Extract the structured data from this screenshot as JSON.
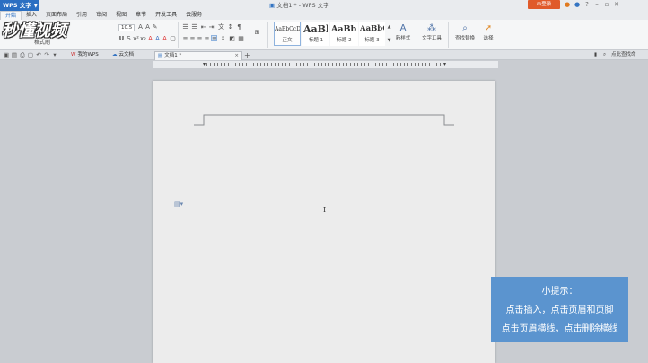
{
  "app": {
    "name": "WPS 文字",
    "title": "文档1 * - WPS 文字",
    "login_label": "未登录"
  },
  "menu": {
    "tabs": [
      {
        "label": "开始",
        "active": true
      },
      {
        "label": "插入"
      },
      {
        "label": "页面布局"
      },
      {
        "label": "引用"
      },
      {
        "label": "审阅"
      },
      {
        "label": "视图"
      },
      {
        "label": "章节"
      },
      {
        "label": "开发工具"
      },
      {
        "label": "云服务"
      }
    ]
  },
  "ribbon": {
    "format_painter_label": "格式刷",
    "font_size": "10.5",
    "styles": [
      {
        "sample": "AaBbCcDd",
        "label": "正文",
        "selected": true
      },
      {
        "sample": "AaBb",
        "label": "标题 1"
      },
      {
        "sample": "AaBb(",
        "label": "标题 2"
      },
      {
        "sample": "AaBbC",
        "label": "标题 3"
      }
    ],
    "new_style_label": "新样式",
    "text_tools_label": "文字工具",
    "find_replace_label": "查找替换",
    "select_label": "选择"
  },
  "watermark": {
    "text": "秒懂视频"
  },
  "doc_tabs": [
    {
      "label": "我的WPS"
    },
    {
      "label": "云文档"
    },
    {
      "label": "文档1 *",
      "active": true
    }
  ],
  "right_tools": {
    "search_label": "点此查找命"
  },
  "tip": {
    "line1": "小提示：",
    "line2": "点击插入，点击页眉和页脚",
    "line3": "点击页眉横线，点击删除横线"
  },
  "colors": {
    "accent": "#2b6fc2",
    "login": "#e05a2a",
    "tip_bg": "#5b94cf",
    "canvas_bg": "#c9ccd1"
  }
}
